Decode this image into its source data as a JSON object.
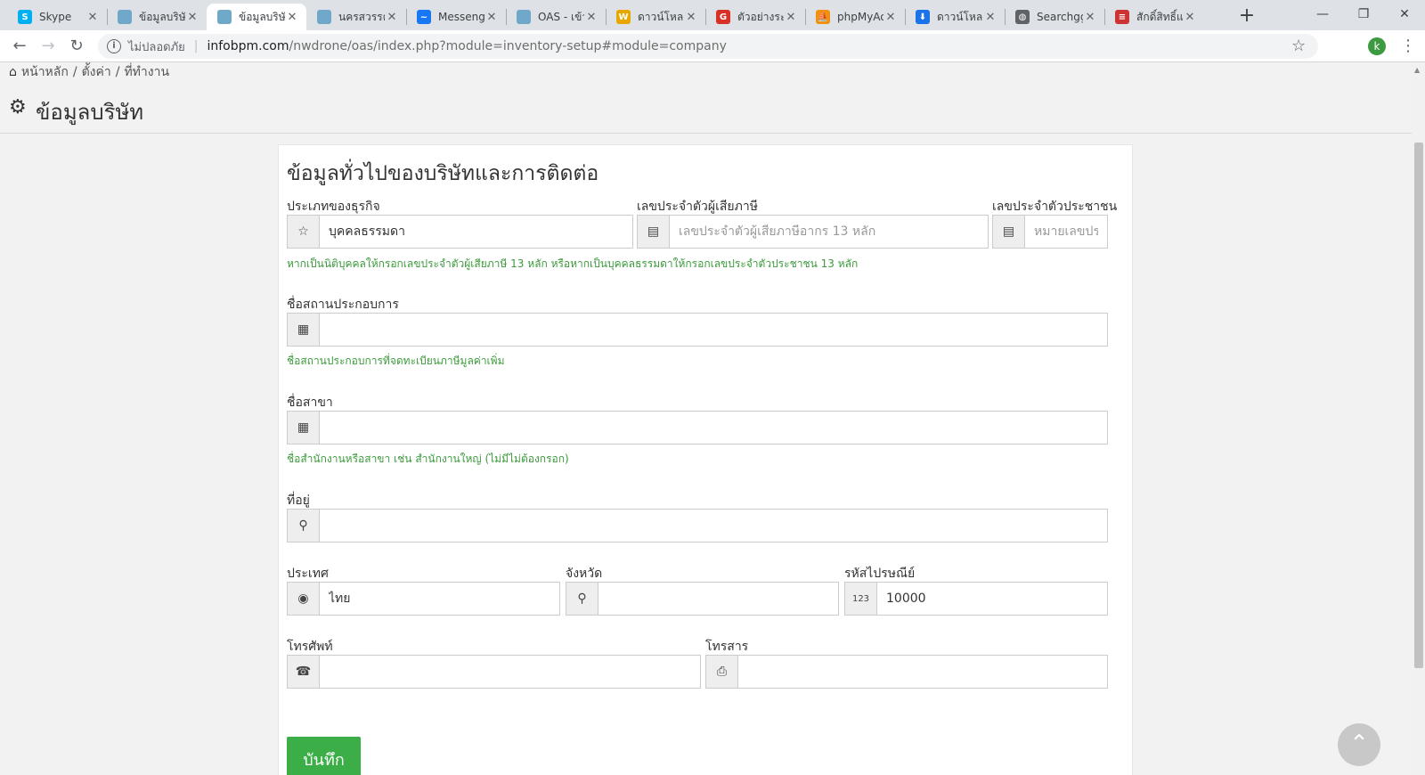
{
  "browser": {
    "tabs": [
      {
        "label": "Skype",
        "icon": "skype-icon",
        "color": "#00aff0",
        "glyph": "S"
      },
      {
        "label": "ข้อมูลบริษั",
        "icon": "elephant-icon",
        "color": "#6fa8c8",
        "glyph": ""
      },
      {
        "label": "ข้อมูลบริษั",
        "icon": "elephant-icon",
        "color": "#6fa8c8",
        "glyph": "",
        "active": true
      },
      {
        "label": "นครสวรรค์",
        "icon": "elephant-icon",
        "color": "#6fa8c8",
        "glyph": ""
      },
      {
        "label": "Messeng",
        "icon": "messenger-icon",
        "color": "#1877f2",
        "glyph": "~"
      },
      {
        "label": "OAS - เข้า",
        "icon": "elephant-icon",
        "color": "#6fa8c8",
        "glyph": ""
      },
      {
        "label": "ดาวน์โหลด",
        "icon": "wsr-icon",
        "color": "#e8a600",
        "glyph": "W"
      },
      {
        "label": "ตัวอย่างระบ",
        "icon": "g-icon",
        "color": "#d93025",
        "glyph": "G"
      },
      {
        "label": "phpMyAc",
        "icon": "phpmyadmin-icon",
        "color": "#f29111",
        "glyph": "⛵"
      },
      {
        "label": "ดาวน์โหลด",
        "icon": "download-icon",
        "color": "#1a73e8",
        "glyph": "⬇"
      },
      {
        "label": "Searchgg",
        "icon": "globe-icon",
        "color": "#5f6368",
        "glyph": "◍"
      },
      {
        "label": "สักดิ์สิทธิ์แ",
        "icon": "flag-icon",
        "color": "#c33",
        "glyph": "≡"
      }
    ],
    "insecure_label": "ไม่ปลอดภัย",
    "url_host": "infobpm.com",
    "url_path": "/nwdrone/oas/index.php?module=inventory-setup#module=company",
    "profile_initial": "k"
  },
  "breadcrumb": {
    "home": "หน้าหลัก",
    "sep1": "/",
    "settings": "ตั้งค่า",
    "sep2": "/",
    "current": "ที่ทำงาน"
  },
  "page": {
    "title": "ข้อมูลบริษัท"
  },
  "form": {
    "section_title": "ข้อมูลทั่วไปของบริษัทและการติดต่อ",
    "business_type": {
      "label": "ประเภทของธุรกิจ",
      "value": "บุคคลธรรมดา"
    },
    "tax_id": {
      "label": "เลขประจำตัวผู้เสียภาษี",
      "placeholder": "เลขประจำตัวผู้เสียภาษีอากร 13 หลัก"
    },
    "citizen_id": {
      "label": "เลขประจำตัวประชาชน",
      "placeholder": "หมายเลขประจำตัวประชาชน"
    },
    "id_hint": "หากเป็นนิติบุคคลให้กรอกเลขประจำตัวผู้เสียภาษี 13 หลัก หรือหากเป็นบุคคลธรรมดาให้กรอกเลขประจำตัวประชาชน 13 หลัก",
    "establishment": {
      "label": "ชื่อสถานประกอบการ",
      "value": "",
      "hint": "ชื่อสถานประกอบการที่จดทะเบียนภาษีมูลค่าเพิ่ม"
    },
    "branch": {
      "label": "ชื่อสาขา",
      "value": "",
      "hint": "ชื่อสำนักงานหรือสาขา เช่น สำนักงานใหญ่ (ไม่มีไม่ต้องกรอก)"
    },
    "address": {
      "label": "ที่อยู่",
      "value": ""
    },
    "country": {
      "label": "ประเทศ",
      "value": "ไทย"
    },
    "province": {
      "label": "จังหวัด",
      "value": ""
    },
    "postcode": {
      "label": "รหัสไปรษณีย์",
      "value": "10000"
    },
    "phone": {
      "label": "โทรศัพท์",
      "value": ""
    },
    "fax": {
      "label": "โทรสาร",
      "value": ""
    },
    "save_label": "บันทึก"
  }
}
